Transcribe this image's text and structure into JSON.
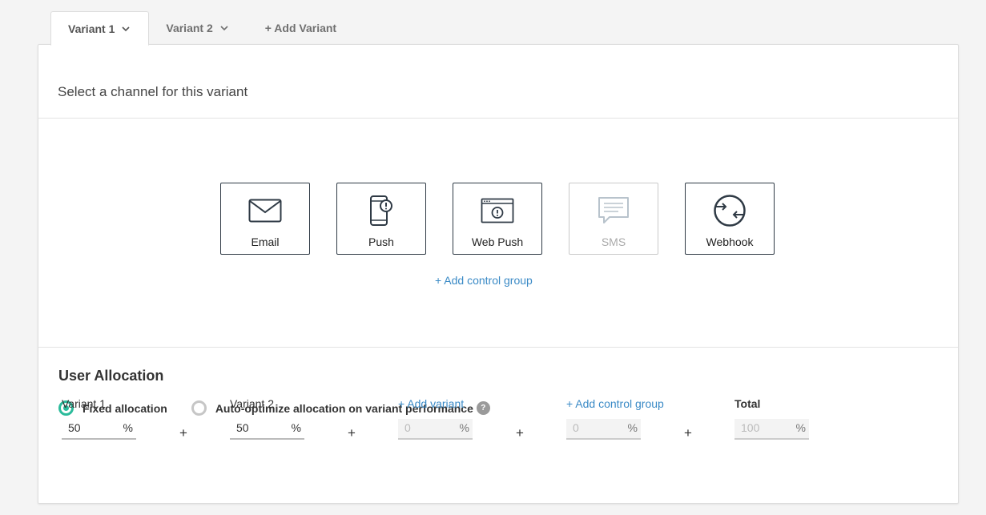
{
  "tabs": [
    {
      "label": "Variant 1",
      "active": true
    },
    {
      "label": "Variant 2",
      "active": false
    },
    {
      "label": "+ Add Variant"
    }
  ],
  "panel": {
    "title": "Select a channel for this variant"
  },
  "channels": [
    {
      "label": "Email",
      "icon": "envelope-icon",
      "enabled": true
    },
    {
      "label": "Push",
      "icon": "mobile-phone-icon",
      "enabled": true
    },
    {
      "label": "Web Push",
      "icon": "browser-window-icon",
      "enabled": true
    },
    {
      "label": "SMS",
      "icon": "chat-bubble-icon",
      "enabled": false
    },
    {
      "label": "Webhook",
      "icon": "arrows-exchange-icon",
      "enabled": true
    }
  ],
  "add_control_group_label": "+ Add control group",
  "allocation": {
    "title": "User Allocation",
    "fixed_label": "Fixed allocation",
    "auto_label": "Auto-optimize allocation on variant performance",
    "help_glyph": "?",
    "selected": "fixed",
    "fields": [
      {
        "label": "Variant 1",
        "value": "50",
        "unit": "%"
      },
      {
        "label": "Variant 2",
        "value": "50",
        "unit": "%"
      },
      {
        "label": "+ Add variant",
        "value": "0",
        "unit": "%"
      },
      {
        "label": "+ Add control group",
        "value": "0",
        "unit": "%"
      },
      {
        "label": "Total",
        "value": "100",
        "unit": "%"
      }
    ],
    "plus_sign": "+"
  },
  "colors": {
    "accent": "#2bbb9b",
    "link": "#3a8ac6",
    "border_dark": "#2f3a45"
  }
}
